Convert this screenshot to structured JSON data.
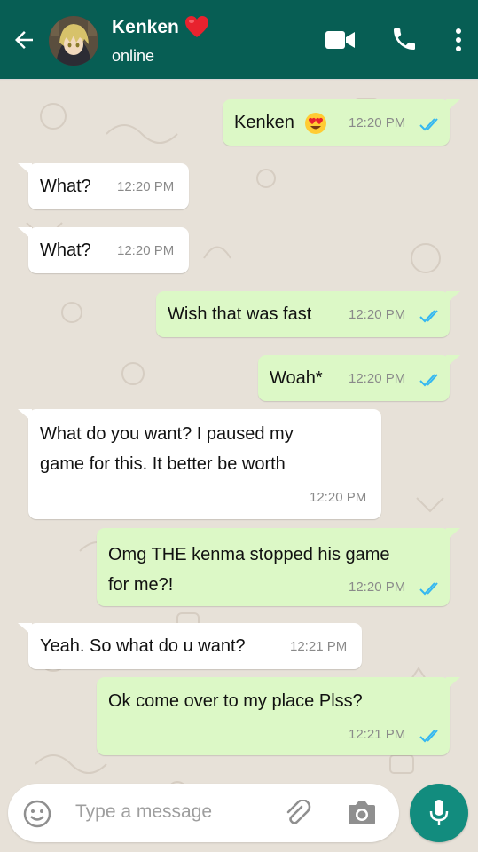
{
  "header": {
    "contact_name": "Kenken",
    "status": "online",
    "icons": [
      "back-arrow-icon",
      "video-call-icon",
      "voice-call-icon",
      "more-options-icon",
      "heart-emoji"
    ]
  },
  "messages": [
    {
      "direction": "outgoing",
      "text": "Kenken",
      "emoji": "heart-eyes-emoji",
      "time": "12:20 PM",
      "read": true
    },
    {
      "direction": "incoming",
      "text": "What?",
      "time": "12:20 PM"
    },
    {
      "direction": "incoming",
      "text": "What?",
      "time": "12:20 PM"
    },
    {
      "direction": "outgoing",
      "text": "Wish that was fast",
      "time": "12:20 PM",
      "read": true
    },
    {
      "direction": "outgoing",
      "text": "Woah*",
      "time": "12:20 PM",
      "read": true
    },
    {
      "direction": "incoming",
      "lines": [
        "What do you want? I paused my",
        "game for this. It better be worth"
      ],
      "time": "12:20 PM"
    },
    {
      "direction": "outgoing",
      "lines": [
        "Omg THE kenma stopped his game",
        "for me?!"
      ],
      "time": "12:20 PM",
      "read": true
    },
    {
      "direction": "incoming",
      "text": "Yeah. So what do u want?",
      "time": "12:21 PM"
    },
    {
      "direction": "outgoing",
      "text": "Ok come over to my place Plss?",
      "time": "12:21 PM",
      "read": true
    }
  ],
  "composer": {
    "placeholder": "Type a message",
    "icons": [
      "emoji-icon",
      "attach-icon",
      "camera-icon",
      "mic-icon"
    ]
  },
  "colors": {
    "header": "#075e54",
    "outgoing_bubble": "#dcf8c6",
    "incoming_bubble": "#ffffff",
    "read_ticks": "#34b7f1",
    "mic_button": "#128c7e",
    "chat_background": "#e5ddd5"
  }
}
